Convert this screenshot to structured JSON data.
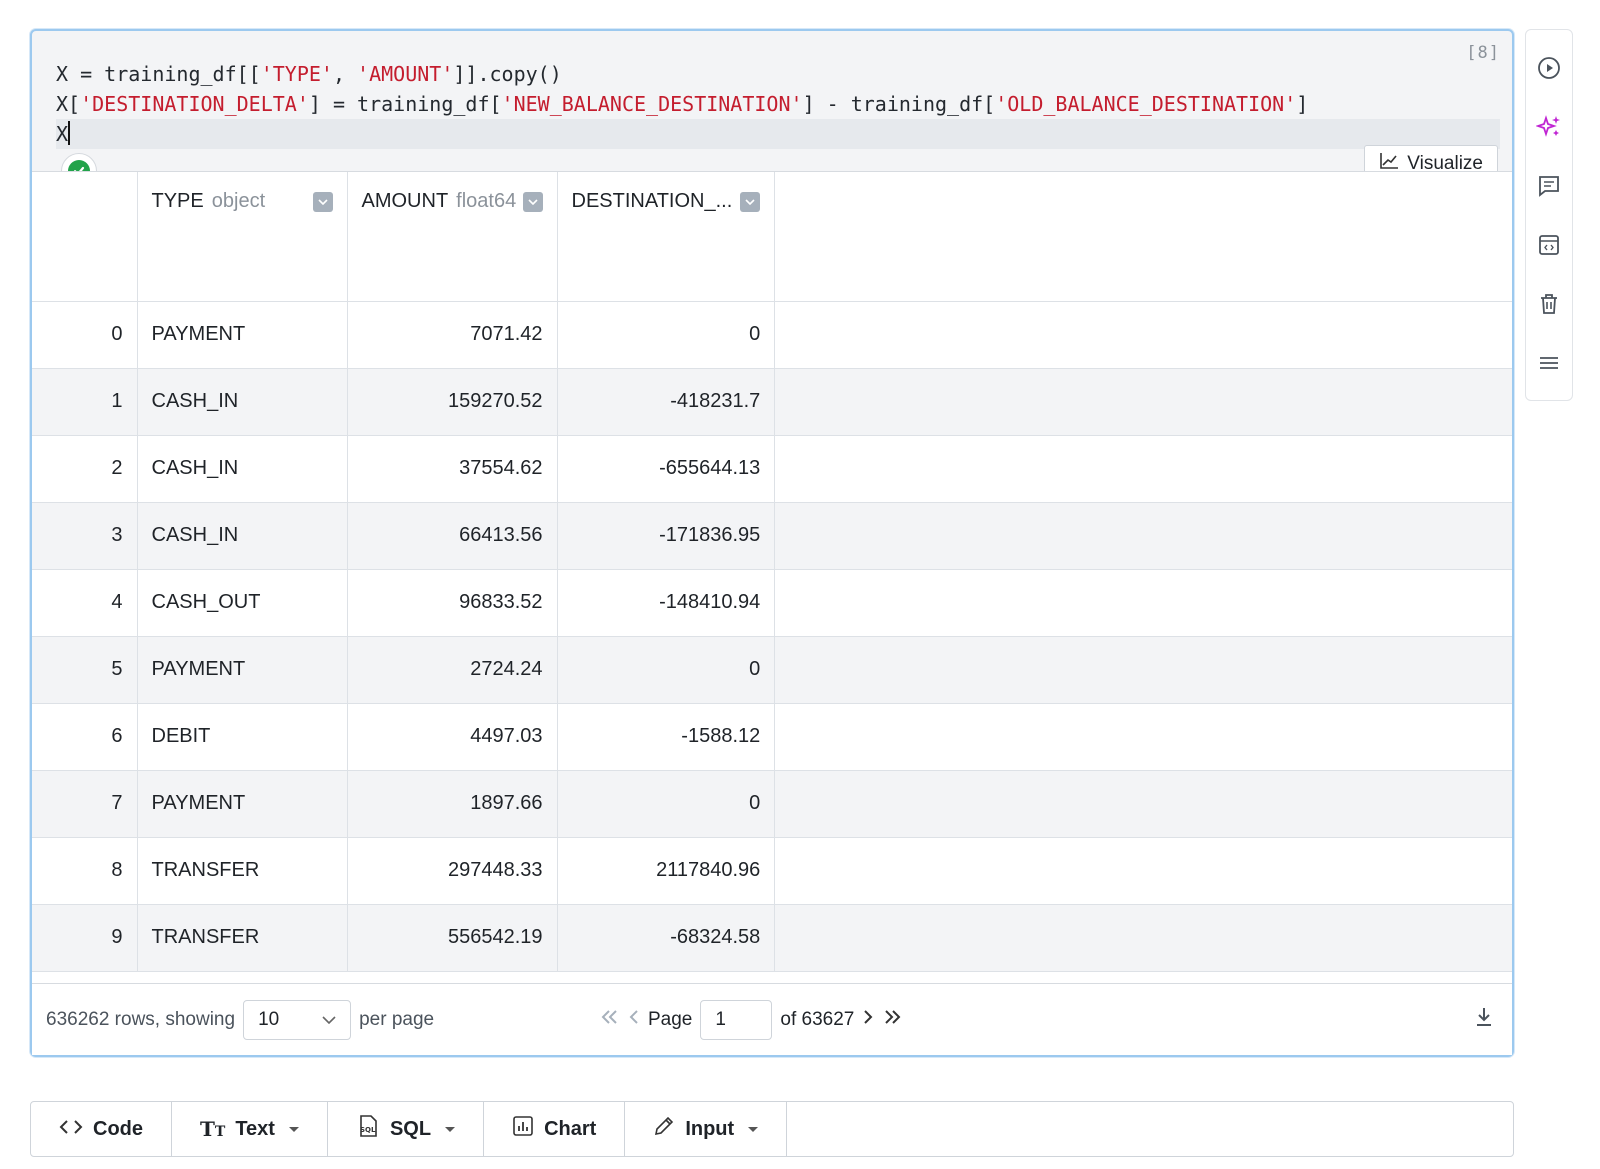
{
  "cell": {
    "execution_count": "[8]",
    "code_lines": [
      [
        {
          "t": "X = training_df[[",
          "c": ""
        },
        {
          "t": "'TYPE'",
          "c": "str"
        },
        {
          "t": ", ",
          "c": ""
        },
        {
          "t": "'AMOUNT'",
          "c": "str"
        },
        {
          "t": "]].copy()",
          "c": ""
        }
      ],
      [
        {
          "t": "X[",
          "c": ""
        },
        {
          "t": "'DESTINATION_DELTA'",
          "c": "str"
        },
        {
          "t": "] = training_df[",
          "c": ""
        },
        {
          "t": "'NEW_BALANCE_DESTINATION'",
          "c": "str"
        },
        {
          "t": "] - training_df[",
          "c": ""
        },
        {
          "t": "'OLD_BALANCE_DESTINATION'",
          "c": "str"
        },
        {
          "t": "]",
          "c": ""
        }
      ],
      [
        {
          "t": "X",
          "c": ""
        }
      ]
    ],
    "status": "success",
    "visualize_label": "Visualize"
  },
  "table": {
    "columns": [
      {
        "name": "TYPE",
        "dtype": "object"
      },
      {
        "name": "AMOUNT",
        "dtype": "float64"
      },
      {
        "name": "DESTINATION_...",
        "dtype": ""
      }
    ],
    "rows": [
      [
        "0",
        "PAYMENT",
        "7071.42",
        "0"
      ],
      [
        "1",
        "CASH_IN",
        "159270.52",
        "-418231.7"
      ],
      [
        "2",
        "CASH_IN",
        "37554.62",
        "-655644.13"
      ],
      [
        "3",
        "CASH_IN",
        "66413.56",
        "-171836.95"
      ],
      [
        "4",
        "CASH_OUT",
        "96833.52",
        "-148410.94"
      ],
      [
        "5",
        "PAYMENT",
        "2724.24",
        "0"
      ],
      [
        "6",
        "DEBIT",
        "4497.03",
        "-1588.12"
      ],
      [
        "7",
        "PAYMENT",
        "1897.66",
        "0"
      ],
      [
        "8",
        "TRANSFER",
        "297448.33",
        "2117840.96"
      ],
      [
        "9",
        "TRANSFER",
        "556542.19",
        "-68324.58"
      ]
    ]
  },
  "pager": {
    "rows_text": "636262 rows, showing",
    "page_size": "10",
    "per_page": "per page",
    "page_label": "Page",
    "page_value": "1",
    "of_text": "of 63627"
  },
  "side_toolbar": [
    "run-icon",
    "ai-sparkle-icon",
    "comment-icon",
    "code-embed-icon",
    "trash-icon",
    "menu-icon"
  ],
  "add_bar": {
    "code": "Code",
    "text": "Text",
    "sql": "SQL",
    "chart": "Chart",
    "input": "Input"
  },
  "colors": {
    "accent": "#9cc9ef",
    "string": "#c41d2e",
    "success": "#22a34a",
    "ai": "#c026d3"
  }
}
